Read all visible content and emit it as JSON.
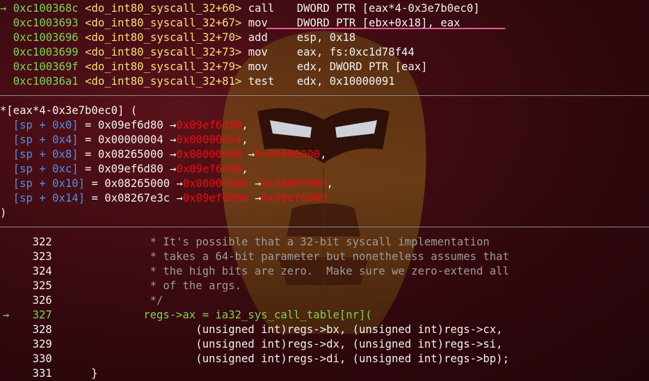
{
  "disasm": [
    {
      "marker": "→",
      "addr": "0xc100368c",
      "sym": "<do_int80_syscall_32+60>",
      "op": "call",
      "args": "DWORD PTR [eax*4-0x3e7b0ec0]"
    },
    {
      "marker": " ",
      "addr": "0xc1003693",
      "sym": "<do_int80_syscall_32+67>",
      "op": "mov",
      "args": "DWORD PTR [ebx+0x18], eax"
    },
    {
      "marker": " ",
      "addr": "0xc1003696",
      "sym": "<do_int80_syscall_32+70>",
      "op": "add",
      "args": "esp, 0x18"
    },
    {
      "marker": " ",
      "addr": "0xc1003699",
      "sym": "<do_int80_syscall_32+73>",
      "op": "mov",
      "args": "eax, fs:0xc1d78f44"
    },
    {
      "marker": " ",
      "addr": "0xc100369f",
      "sym": "<do_int80_syscall_32+79>",
      "op": "mov",
      "args": "edx, DWORD PTR [eax]"
    },
    {
      "marker": " ",
      "addr": "0xc10036a1",
      "sym": "<do_int80_syscall_32+81>",
      "op": "test",
      "args": "edx, 0x10000091"
    }
  ],
  "call_args": {
    "header": "*[eax*4-0x3e7b0ec0] (",
    "rows": [
      {
        "reg": "[sp + 0x0]",
        "eq": " = ",
        "val": "0x09ef6d80",
        "chain": [
          "0x09ef6d80"
        ],
        "trail": ","
      },
      {
        "reg": "[sp + 0x4]",
        "eq": " = ",
        "val": "0x00000004",
        "chain": [
          "0x00000004"
        ],
        "trail": ","
      },
      {
        "reg": "[sp + 0x8]",
        "eq": " = ",
        "val": "0x08265000",
        "chain": [
          "0x00000000",
          "0x00000000"
        ],
        "trail": ","
      },
      {
        "reg": "[sp + 0xc]",
        "eq": " = ",
        "val": "0x09ef6d80",
        "chain": [
          "0x09ef6d80"
        ],
        "trail": ","
      },
      {
        "reg": "[sp + 0x10]",
        "eq": " = ",
        "val": "0x08265000",
        "chain": [
          "0x00000000",
          "0x00000000"
        ],
        "trail": ","
      },
      {
        "reg": "[sp + 0x14]",
        "eq": " = ",
        "val": "0x08267e3c",
        "chain": [
          "0x09ef6000",
          "0x09ef6000"
        ],
        "trail": ""
      }
    ],
    "footer": ")"
  },
  "source": [
    {
      "marker": " ",
      "num": "322",
      "text": "               * It's possible that a 32-bit syscall implementation",
      "kind": "comment"
    },
    {
      "marker": " ",
      "num": "323",
      "text": "               * takes a 64-bit parameter but nonetheless assumes that",
      "kind": "comment"
    },
    {
      "marker": " ",
      "num": "324",
      "text": "               * the high bits are zero.  Make sure we zero-extend all",
      "kind": "comment"
    },
    {
      "marker": " ",
      "num": "325",
      "text": "               * of the args.",
      "kind": "comment"
    },
    {
      "marker": " ",
      "num": "326",
      "text": "               */",
      "kind": "comment"
    },
    {
      "marker": "→",
      "num": "327",
      "text": "              regs->ax = ia32_sys_call_table[nr](",
      "kind": "current"
    },
    {
      "marker": " ",
      "num": "328",
      "text": "                      (unsigned int)regs->bx, (unsigned int)regs->cx,",
      "kind": "code"
    },
    {
      "marker": " ",
      "num": "329",
      "text": "                      (unsigned int)regs->dx, (unsigned int)regs->si,",
      "kind": "code"
    },
    {
      "marker": " ",
      "num": "330",
      "text": "                      (unsigned int)regs->di, (unsigned int)regs->bp);",
      "kind": "code"
    },
    {
      "marker": " ",
      "num": "331",
      "text": "      }",
      "kind": "code"
    }
  ],
  "colors": {
    "background": "#3f0b12",
    "address": "#7fd455",
    "symbol": "#f3e07a",
    "register": "#4f8fe6",
    "deref": "#e60f0f",
    "comment": "#9c9c9c",
    "highlight": "#e85a9a"
  },
  "icons": {
    "pc_marker": "right-arrow-icon",
    "watermark": "iron-man-helmet-icon"
  }
}
